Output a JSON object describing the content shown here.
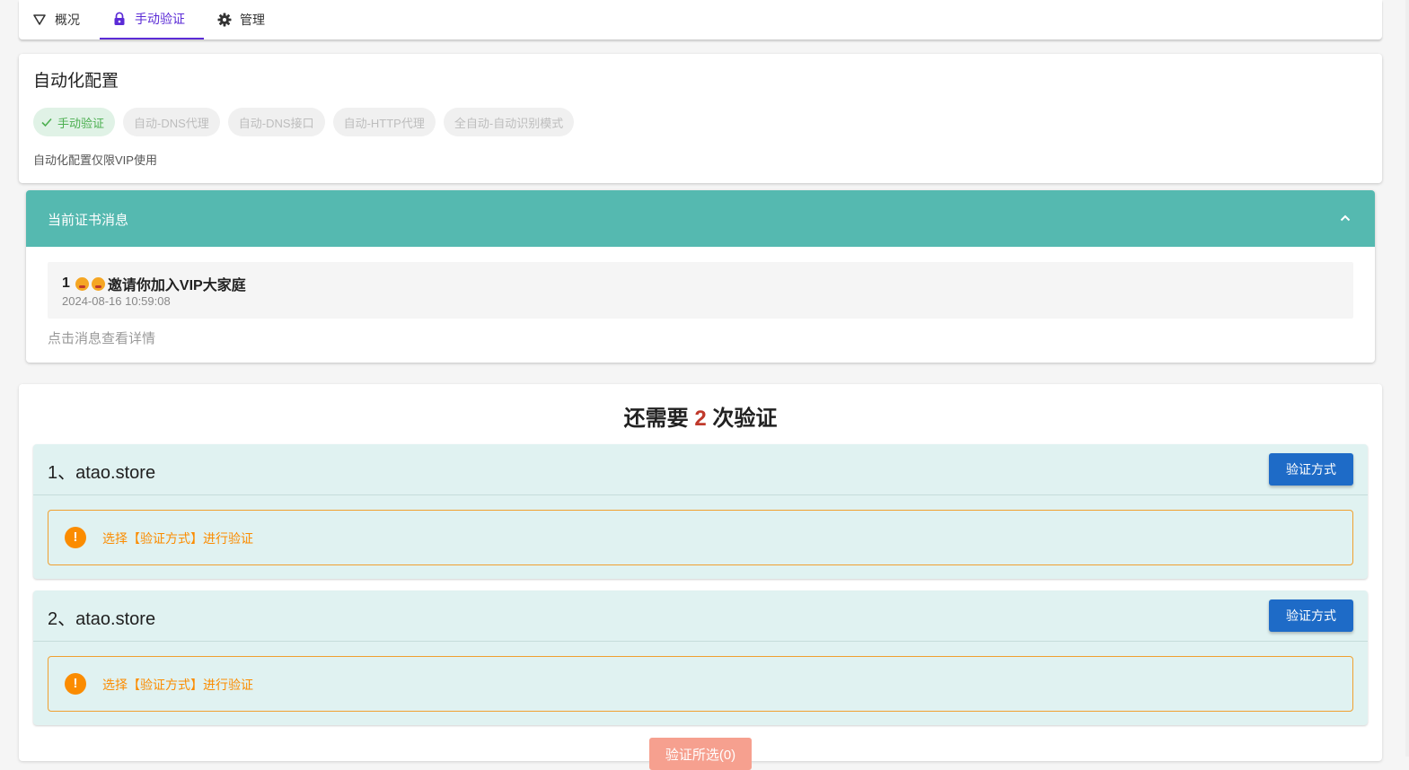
{
  "tabs": [
    {
      "label": "概况",
      "icon": "filter-icon"
    },
    {
      "label": "手动验证",
      "icon": "lock-icon",
      "active": true
    },
    {
      "label": "管理",
      "icon": "gear-icon"
    }
  ],
  "auto_config": {
    "title": "自动化配置",
    "options": [
      {
        "label": "手动验证",
        "selected": true
      },
      {
        "label": "自动-DNS代理",
        "selected": false
      },
      {
        "label": "自动-DNS接口",
        "selected": false
      },
      {
        "label": "自动-HTTP代理",
        "selected": false
      },
      {
        "label": "全自动-自动识别模式",
        "selected": false
      }
    ],
    "note": "自动化配置仅限VIP使用"
  },
  "cert_messages": {
    "title": "当前证书消息",
    "items": [
      {
        "index": "1",
        "title": "邀请你加入VIP大家庭",
        "time": "2024-08-16 10:59:08"
      }
    ],
    "hint": "点击消息查看详情"
  },
  "verify": {
    "title_prefix": "还需要",
    "remaining": "2",
    "title_suffix": "次验证",
    "domains": [
      {
        "name": "1、atao.store",
        "button": "验证方式",
        "alert": "选择【验证方式】进行验证"
      },
      {
        "name": "2、atao.store",
        "button": "验证方式",
        "alert": "选择【验证方式】进行验证"
      }
    ],
    "submit_label": "验证所选(0)"
  },
  "colors": {
    "accent_tab": "#5b2bd6",
    "panel_header": "#55b9b0",
    "button_primary": "#1e6bc7",
    "warning": "#fb8c00",
    "chip_active": "#4caf50",
    "count": "#c0392b"
  }
}
